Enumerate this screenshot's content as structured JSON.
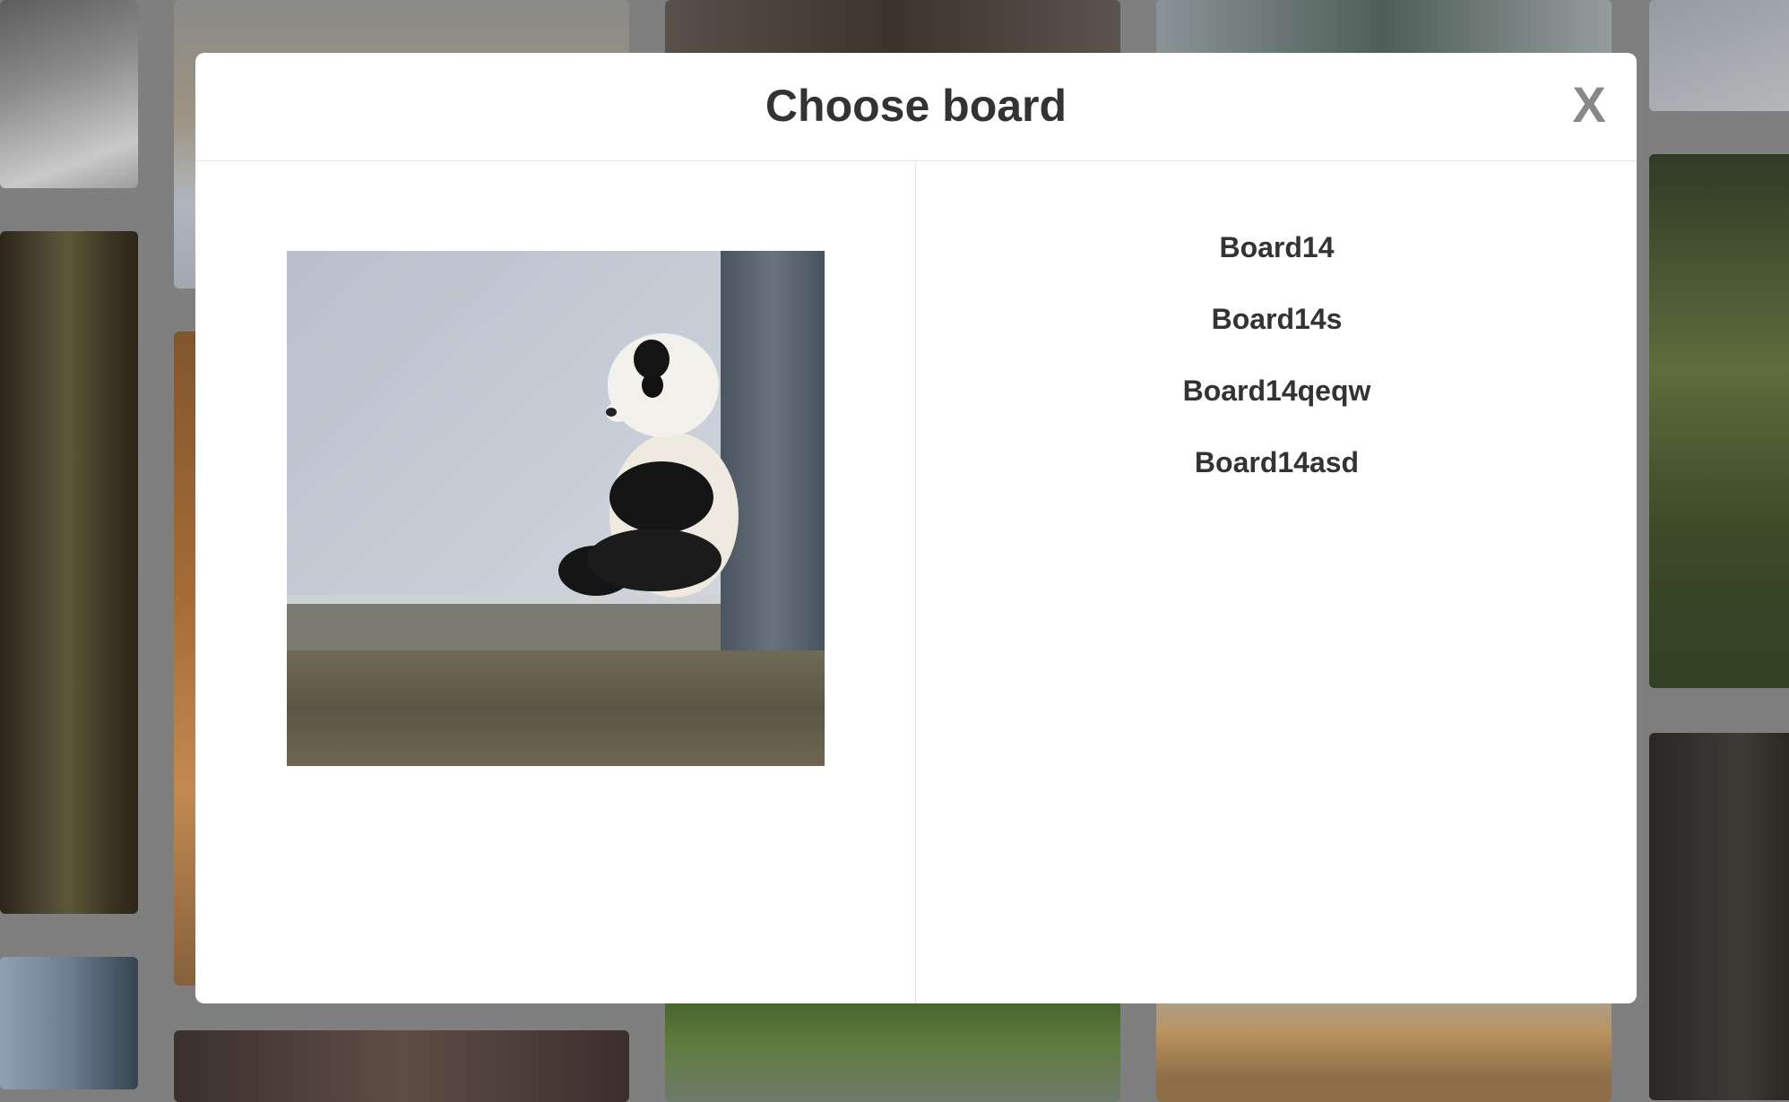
{
  "modal": {
    "title": "Choose board",
    "close_label": "X"
  },
  "pin": {
    "image_icon": "panda-photo"
  },
  "boards": [
    {
      "label": "Board14"
    },
    {
      "label": "Board14s"
    },
    {
      "label": "Board14qeqw"
    },
    {
      "label": "Board14asd"
    }
  ]
}
